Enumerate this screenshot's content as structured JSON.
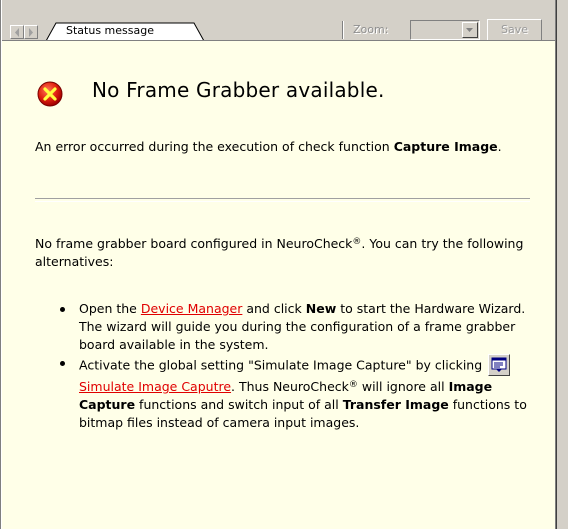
{
  "toolbar": {
    "tab_label": "Status message",
    "zoom_label": "Zoom:",
    "zoom_value": "",
    "save_label": "Save",
    "prev_icon": "arrow-left-icon",
    "next_icon": "arrow-right-icon"
  },
  "message": {
    "icon": "error-icon",
    "title": "No Frame Grabber available.",
    "error_prefix": "An error occurred during the execution of check function ",
    "error_function": "Capture Image",
    "error_suffix": ".",
    "intro_a": "No frame grabber board configured in NeuroCheck",
    "intro_reg": "®",
    "intro_b": ". You can try the following alternatives:"
  },
  "alternatives": [
    {
      "a": "Open the ",
      "link": "Device Manager",
      "b": " and click ",
      "bold1": "New",
      "c": " to start the Hardware Wizard. The wizard will guide you during the configuration of a frame grabber board available in the system."
    },
    {
      "a": "Activate the global setting \"Simulate Image Capture\" by clicking ",
      "button_icon": "simulate-capture-icon",
      "link": "Simulate Image Caputre",
      "b": ". Thus NeuroCheck",
      "reg": "®",
      "c": " will ignore all ",
      "bold1": "Image Capture",
      "d": " functions and switch input of all ",
      "bold2": "Transfer Image",
      "e": " functions to bitmap files instead of camera input images."
    }
  ],
  "colors": {
    "background": "#ffffe8",
    "link": "#e00000",
    "error_red": "#e02010"
  }
}
